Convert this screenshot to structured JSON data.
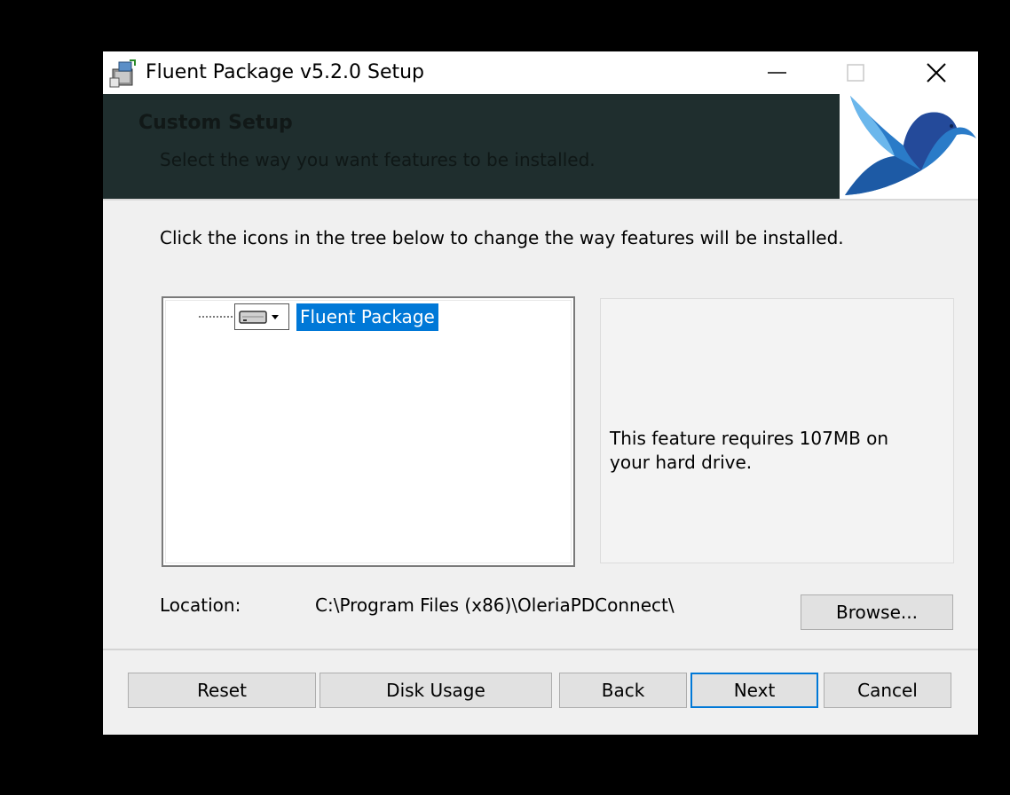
{
  "window": {
    "title": "Fluent Package v5.2.0 Setup"
  },
  "banner": {
    "title": "Custom Setup",
    "subtitle": "Select the way you want features to be installed."
  },
  "main": {
    "instructions": "Click the icons in the tree below to change the way features will be installed.",
    "tree": {
      "items": [
        {
          "label": "Fluent Package",
          "selected": true,
          "icon": "hard-drive-icon"
        }
      ]
    },
    "feature_info": "This feature requires 107MB on your hard drive.",
    "location_label": "Location:",
    "location_value": "C:\\Program Files (x86)\\OleriaPDConnect\\",
    "browse_label": "Browse..."
  },
  "footer": {
    "reset_label": "Reset",
    "disk_usage_label": "Disk Usage",
    "back_label": "Back",
    "next_label": "Next",
    "cancel_label": "Cancel"
  },
  "colors": {
    "banner_bg": "#1f2e2e",
    "selection": "#0078d7",
    "focus_border": "#0078d7"
  }
}
